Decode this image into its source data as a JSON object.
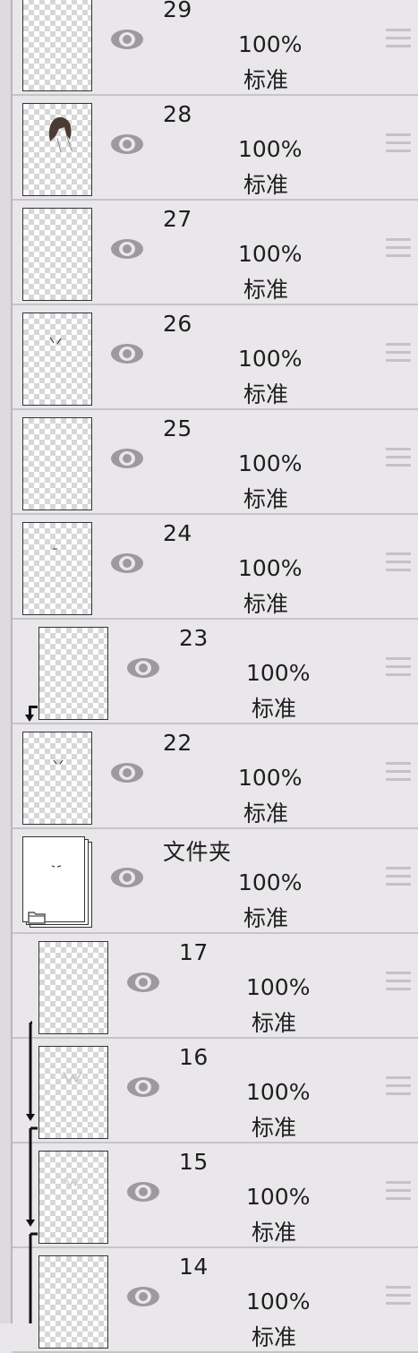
{
  "layers": [
    {
      "name": "29",
      "opacity": "100%",
      "mode": "标准"
    },
    {
      "name": "28",
      "opacity": "100%",
      "mode": "标准"
    },
    {
      "name": "27",
      "opacity": "100%",
      "mode": "标准"
    },
    {
      "name": "26",
      "opacity": "100%",
      "mode": "标准"
    },
    {
      "name": "25",
      "opacity": "100%",
      "mode": "标准"
    },
    {
      "name": "24",
      "opacity": "100%",
      "mode": "标准"
    },
    {
      "name": "23",
      "opacity": "100%",
      "mode": "标准"
    },
    {
      "name": "22",
      "opacity": "100%",
      "mode": "标准"
    },
    {
      "name": "文件夹",
      "opacity": "100%",
      "mode": "标准"
    },
    {
      "name": "17",
      "opacity": "100%",
      "mode": "标准"
    },
    {
      "name": "16",
      "opacity": "100%",
      "mode": "标准"
    },
    {
      "name": "15",
      "opacity": "100%",
      "mode": "标准"
    },
    {
      "name": "14",
      "opacity": "100%",
      "mode": "标准"
    }
  ],
  "icons": {
    "visibility": "eye-icon",
    "handle": "drag-handle-icon",
    "folder": "folder-icon",
    "clipping": "clipping-arrow-icon"
  },
  "colors": {
    "row_bg": "#e9e7ea",
    "divider": "#c6c4c8",
    "eye": "#9c9a9e",
    "handle": "#c4c2c6"
  }
}
